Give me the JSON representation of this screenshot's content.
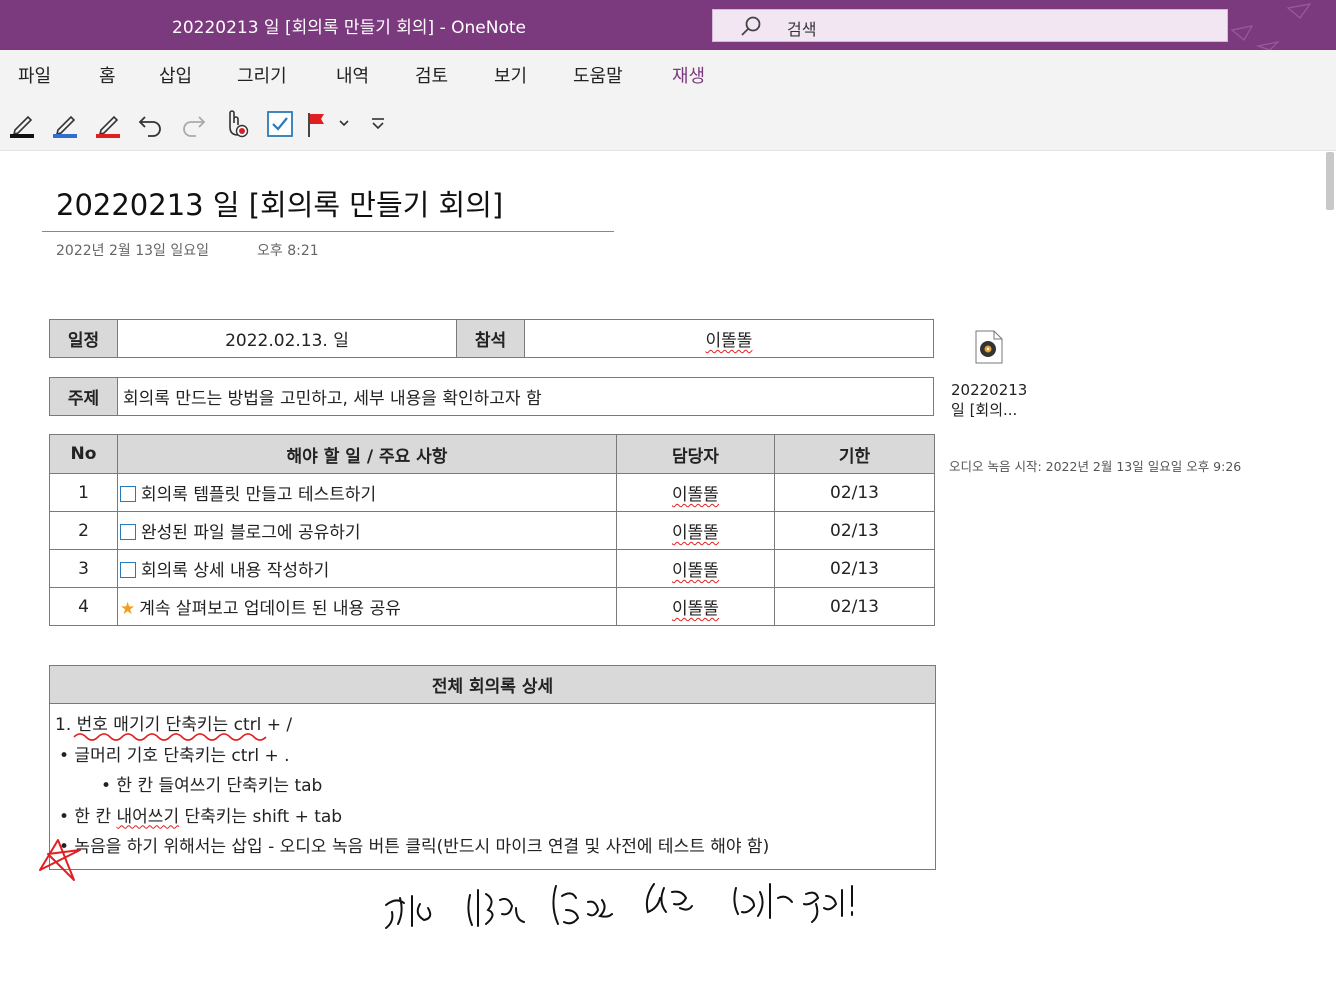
{
  "window": {
    "title": "20220213 일 [회의록 만들기 회의]  -  OneNote",
    "search_placeholder": "검색",
    "accent_color": "#7b3a7e"
  },
  "menu": {
    "items": [
      "파일",
      "홈",
      "삽입",
      "그리기",
      "내역",
      "검토",
      "보기",
      "도움말",
      "재생"
    ],
    "active": "재생"
  },
  "toolbar": {
    "icons": [
      "pen-black-icon",
      "pen-blue-icon",
      "pen-red-icon",
      "undo-icon",
      "redo-icon",
      "touch-draw-icon",
      "todo-checkbox-icon",
      "flag-icon",
      "dropdown-chevron-icon",
      "customize-toolbar-icon"
    ]
  },
  "page": {
    "title": "20220213 일 [회의록 만들기 회의]",
    "date": "2022년 2월 13일 일요일",
    "time": "오후 8:21"
  },
  "info": {
    "schedule_label": "일정",
    "schedule_value": "2022.02.13. 일",
    "attendee_label": "참석",
    "attendee_value": "이똘똘",
    "topic_label": "주제",
    "topic_value": "회의록 만드는 방법을 고민하고, 세부 내용을 확인하고자 함"
  },
  "tasks": {
    "headers": [
      "No",
      "해야 할 일 / 주요 사항",
      "담당자",
      "기한"
    ],
    "rows": [
      {
        "no": "1",
        "task": "회의록 템플릿 만들고 테스트하기",
        "owner": "이똘똘",
        "due": "02/13",
        "tag": "checkbox"
      },
      {
        "no": "2",
        "task": "완성된 파일 블로그에 공유하기",
        "owner": "이똘똘",
        "due": "02/13",
        "tag": "checkbox"
      },
      {
        "no": "3",
        "task": "회의록 상세 내용 작성하기",
        "owner": "이똘똘",
        "due": "02/13",
        "tag": "checkbox"
      },
      {
        "no": "4",
        "task": "계속 살펴보고 업데이트 된 내용 공유",
        "owner": "이똘똘",
        "due": "02/13",
        "tag": "star"
      }
    ]
  },
  "detail": {
    "header": "전체 회의록 상세",
    "line1_num": "1. ",
    "line1_underlined": "번호 매기기 단축키는",
    "line1_rest": " ctrl + /",
    "line2": "• 글머리 기호 단축키는 ctrl + .",
    "line3": "• 한 칸 들여쓰기 단축키는 tab",
    "line4_a": "• 한 칸 ",
    "line4_spell": "내어쓰기",
    "line4_b": " 단축키는 shift + tab",
    "line5": "• 녹음을 하기 위해서는 삽입 - 오디오 녹음 버튼 클릭(반드시 마이크 연결 및 사전에 테스트 해야 함)"
  },
  "audio": {
    "name_line1": "20220213",
    "name_line2": "일 [회의...",
    "meta": "오디오 녹음 시작: 2022년 2월 13일 일요일 오후 9:26"
  },
  "ink": {
    "handwriting": "급한 내용은 펜으로 쓰고 나중에 정리!",
    "colors": {
      "red": "#e02020",
      "black": "#111111"
    }
  }
}
